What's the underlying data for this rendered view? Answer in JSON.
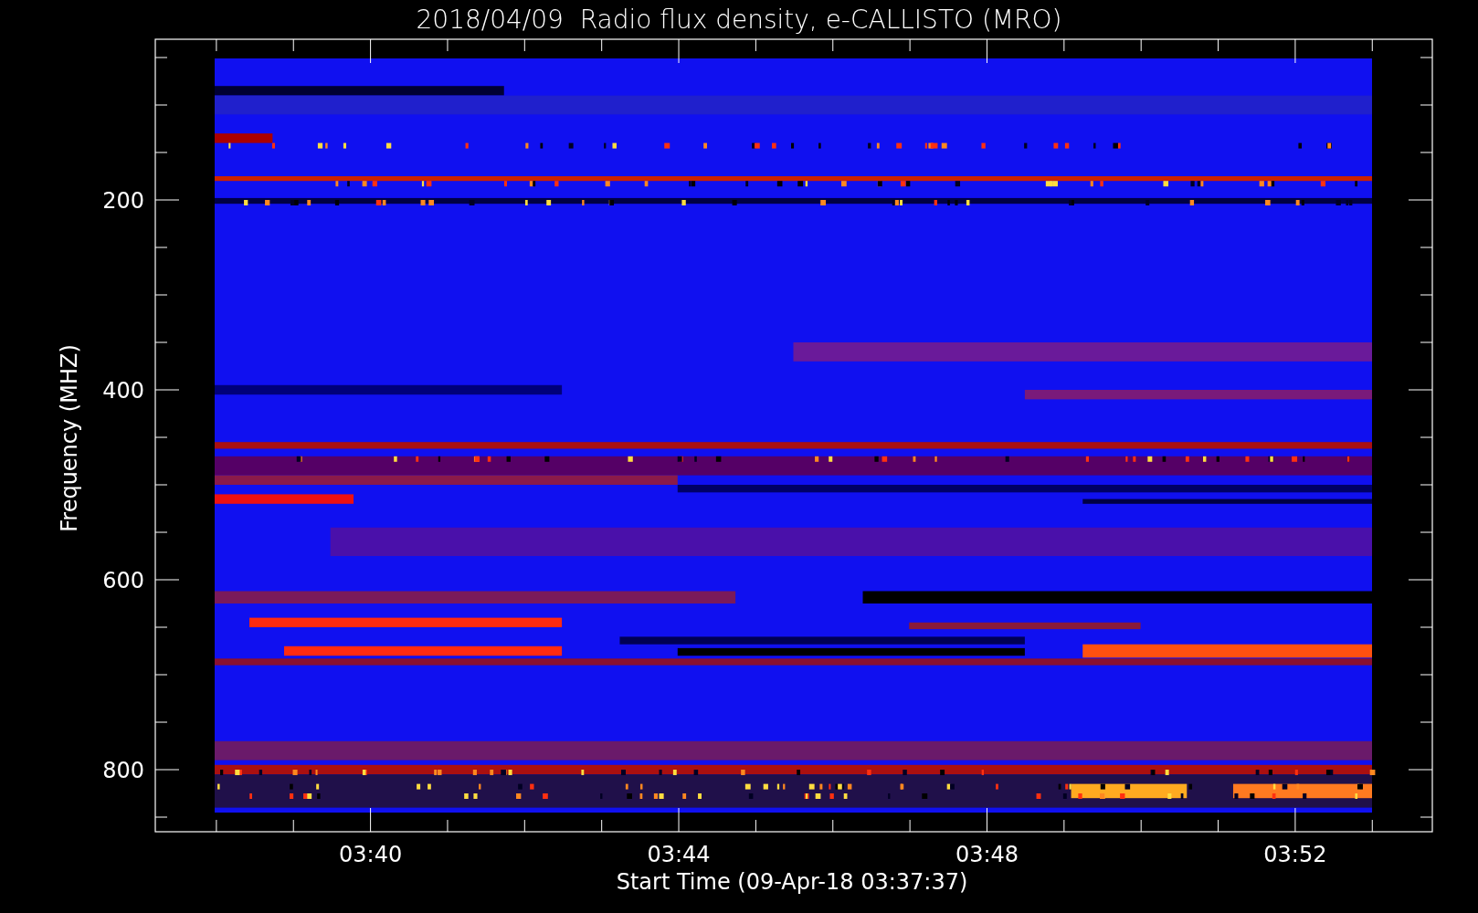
{
  "title": "2018/04/09  Radio flux density, e-CALLISTO (MRO)",
  "ylabel": "Frequency (MHZ)",
  "xlabel": "Start Time (09-Apr-18 03:37:37)",
  "yticks": [
    "200",
    "400",
    "600",
    "800"
  ],
  "xticks": [
    "03:40",
    "03:44",
    "03:48",
    "03:52"
  ]
}
